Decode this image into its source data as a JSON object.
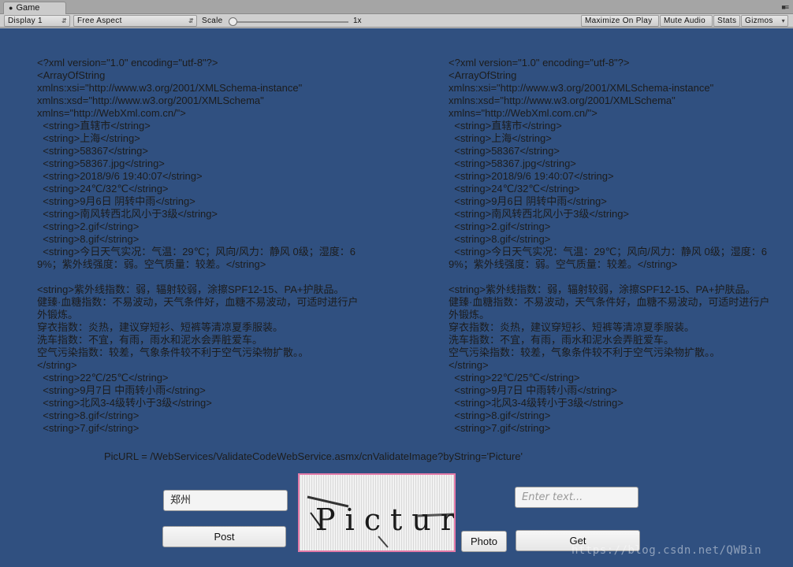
{
  "window": {
    "tab_title": "Game",
    "tab_icon": "pacman-icon",
    "menu_icon": "menu-icon"
  },
  "toolbar": {
    "display": "Display 1",
    "aspect": "Free Aspect",
    "scale_label": "Scale",
    "scale_value": "1x",
    "maximize_on_play": "Maximize On Play",
    "mute_audio": "Mute Audio",
    "stats": "Stats",
    "gizmos": "Gizmos"
  },
  "xml_left": "<?xml version=\"1.0\" encoding=\"utf-8\"?>\n<ArrayOfString\nxmlns:xsi=\"http://www.w3.org/2001/XMLSchema-instance\"\nxmlns:xsd=\"http://www.w3.org/2001/XMLSchema\"\nxmlns=\"http://WebXml.com.cn/\">\n  <string>直辖市</string>\n  <string>上海</string>\n  <string>58367</string>\n  <string>58367.jpg</string>\n  <string>2018/9/6 19:40:07</string>\n  <string>24℃/32℃</string>\n  <string>9月6日 阴转中雨</string>\n  <string>南风转西北风小于3级</string>\n  <string>2.gif</string>\n  <string>8.gif</string>\n  <string>今日天气实况：气温：29℃；风向/风力：静风 0级；湿度：69%；紫外线强度：弱。空气质量：较差。</string>\n\n<string>紫外线指数：弱，辐射较弱，涂擦SPF12-15、PA+护肤品。\n健臻·血糖指数：不易波动，天气条件好，血糖不易波动，可适时进行户外锻炼。\n穿衣指数：炎热，建议穿短衫、短裤等清凉夏季服装。\n洗车指数：不宜，有雨，雨水和泥水会弄脏爱车。\n空气污染指数：较差，气象条件较不利于空气污染物扩散。。\n</string>\n  <string>22℃/25℃</string>\n  <string>9月7日 中雨转小雨</string>\n  <string>北风3-4级转小于3级</string>\n  <string>8.gif</string>\n  <string>7.gif</string>",
  "xml_right": "<?xml version=\"1.0\" encoding=\"utf-8\"?>\n<ArrayOfString\nxmlns:xsi=\"http://www.w3.org/2001/XMLSchema-instance\"\nxmlns:xsd=\"http://www.w3.org/2001/XMLSchema\"\nxmlns=\"http://WebXml.com.cn/\">\n  <string>直辖市</string>\n  <string>上海</string>\n  <string>58367</string>\n  <string>58367.jpg</string>\n  <string>2018/9/6 19:40:07</string>\n  <string>24℃/32℃</string>\n  <string>9月6日 阴转中雨</string>\n  <string>南风转西北风小于3级</string>\n  <string>2.gif</string>\n  <string>8.gif</string>\n  <string>今日天气实况：气温：29℃；风向/风力：静风 0级；湿度：69%；紫外线强度：弱。空气质量：较差。</string>\n\n<string>紫外线指数：弱，辐射较弱，涂擦SPF12-15、PA+护肤品。\n健臻·血糖指数：不易波动，天气条件好，血糖不易波动，可适时进行户外锻炼。\n穿衣指数：炎热，建议穿短衫、短裤等清凉夏季服装。\n洗车指数：不宜，有雨，雨水和泥水会弄脏爱车。\n空气污染指数：较差，气象条件较不利于空气污染物扩散。。\n</string>\n  <string>22℃/25℃</string>\n  <string>9月7日 中雨转小雨</string>\n  <string>北风3-4级转小于3级</string>\n  <string>8.gif</string>\n  <string>7.gif</string>",
  "picurl": "PicURL = /WebServices/ValidateCodeWebService.asmx/cnValidateImage?byString='Picture'",
  "form": {
    "city_value": "郑州",
    "text_placeholder": "Enter text...",
    "post_label": "Post",
    "photo_label": "Photo",
    "get_label": "Get"
  },
  "captcha_text": "Picture",
  "watermark": "https://blog.csdn.net/QWBin",
  "colors": {
    "game_background": "#305080",
    "captcha_border": "#e37aa8"
  }
}
